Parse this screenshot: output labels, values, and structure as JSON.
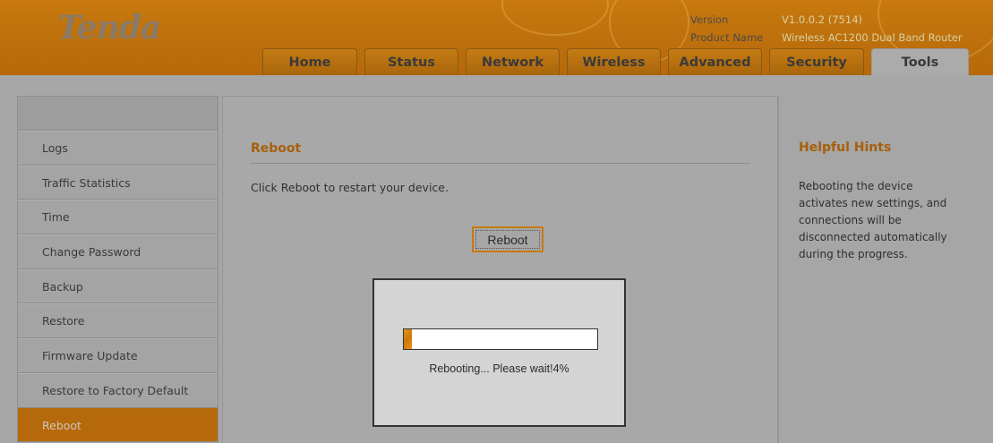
{
  "header": {
    "logo": "Tenda",
    "version_label": "Version",
    "version_value": "V1.0.0.2 (7514)",
    "product_label": "Product Name",
    "product_value": "Wireless AC1200 Dual Band Router"
  },
  "nav": {
    "tabs": [
      {
        "label": "Home"
      },
      {
        "label": "Status"
      },
      {
        "label": "Network"
      },
      {
        "label": "Wireless"
      },
      {
        "label": "Advanced"
      },
      {
        "label": "Security"
      },
      {
        "label": "Tools"
      }
    ],
    "active": "Tools"
  },
  "sidebar": {
    "items": [
      {
        "label": "Logs"
      },
      {
        "label": "Traffic Statistics"
      },
      {
        "label": "Time"
      },
      {
        "label": "Change Password"
      },
      {
        "label": "Backup"
      },
      {
        "label": "Restore"
      },
      {
        "label": "Firmware Update"
      },
      {
        "label": "Restore to Factory Default"
      },
      {
        "label": "Reboot"
      }
    ],
    "active": "Reboot"
  },
  "main": {
    "title": "Reboot",
    "description": "Click Reboot to restart your device.",
    "button_label": "Reboot"
  },
  "hints": {
    "title": "Helpful Hints",
    "text": "Rebooting the device activates new settings, and connections will be disconnected automatically during the progress."
  },
  "modal": {
    "progress_text": "Rebooting... Please wait!4%",
    "progress_fraction": 0.04
  },
  "colors": {
    "brand_orange": "#b5690a",
    "accent_text": "#a7600b",
    "overlay_gray": "#a7a7a7"
  }
}
